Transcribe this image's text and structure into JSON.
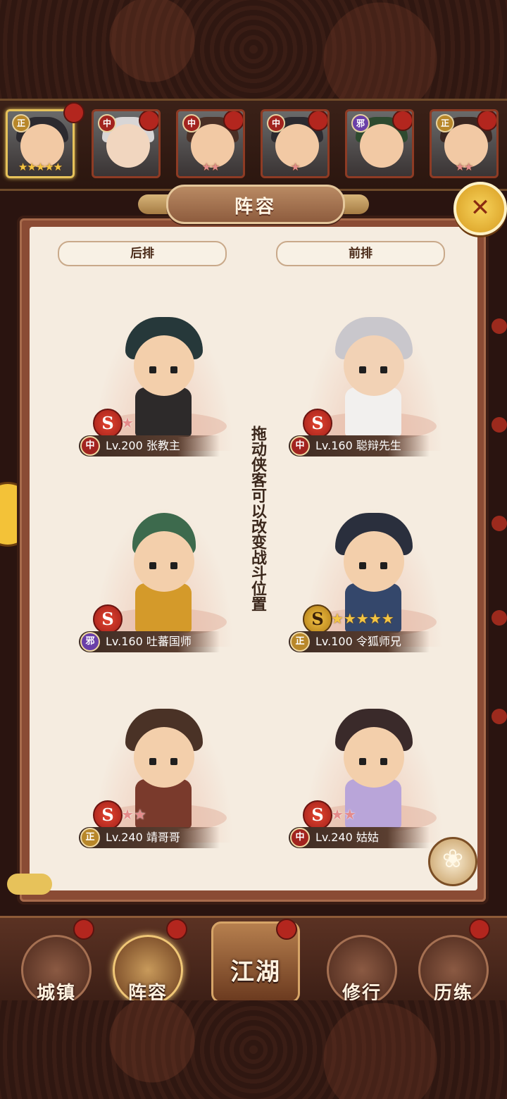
{
  "panel": {
    "title": "阵容",
    "close_icon": "✕",
    "back_row_label": "后排",
    "front_row_label": "前排",
    "hint": "拖动侠客可以改变战斗位置"
  },
  "hero_strip": [
    {
      "tag": "正",
      "stars": "★★★★★",
      "selected": true
    },
    {
      "tag": "中",
      "stars": "",
      "selected": false
    },
    {
      "tag": "中",
      "stars": "★★",
      "selected": false
    },
    {
      "tag": "中",
      "stars": "★",
      "selected": false
    },
    {
      "tag": "邪",
      "stars": "",
      "selected": false
    },
    {
      "tag": "正",
      "stars": "★★",
      "selected": false
    }
  ],
  "slots": [
    {
      "tag": "中",
      "level": "Lv.200",
      "name": "张教主",
      "grade": "S",
      "stars": "★"
    },
    {
      "tag": "中",
      "level": "Lv.160",
      "name": "聪辩先生",
      "grade": "S",
      "stars": ""
    },
    {
      "tag": "邪",
      "level": "Lv.160",
      "name": "吐蕃国师",
      "grade": "S",
      "stars": ""
    },
    {
      "tag": "正",
      "level": "Lv.100",
      "name": "令狐师兄",
      "grade": "S",
      "stars": "★★★★★"
    },
    {
      "tag": "正",
      "level": "Lv.240",
      "name": "靖哥哥",
      "grade": "S",
      "stars": "★★"
    },
    {
      "tag": "中",
      "level": "Lv.240",
      "name": "姑姑",
      "grade": "S",
      "stars": "★★"
    }
  ],
  "nav": {
    "town": "城镇",
    "lineup": "阵容",
    "jianghu": "江湖",
    "training": "修行",
    "trial": "历练"
  },
  "colors": {
    "zheng": "#b8872a",
    "zhong": "#a2241f",
    "xie": "#6a3fa8",
    "accent_gold": "#e7c25a"
  }
}
